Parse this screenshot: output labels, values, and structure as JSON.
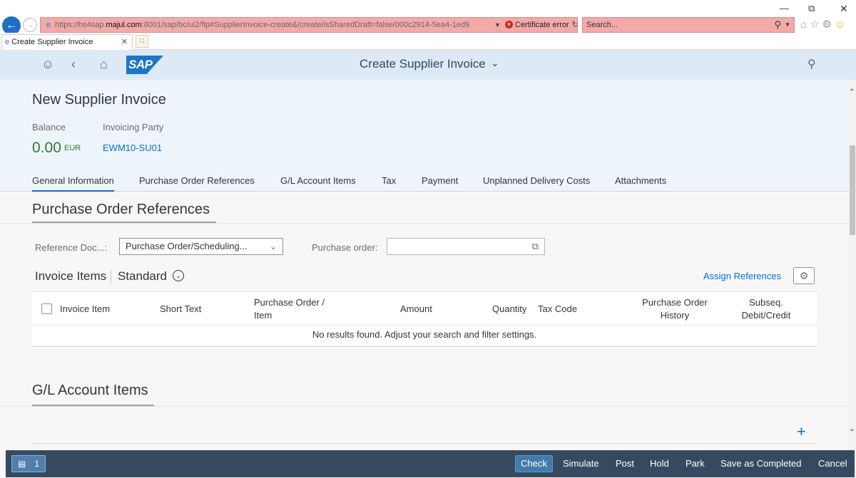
{
  "browser": {
    "url_prefix": "https://hs4sap.",
    "url_domain": "majul.com",
    "url_rest": ":8001/sap/bc/ui2/flp#SupplierInvoice-create&/create/isSharedDraft=false/000c2914-5ea4-1ed9",
    "certificate_error": "Certificate error",
    "search_placeholder": "Search...",
    "tab_title": "Create Supplier Invoice"
  },
  "shell": {
    "logo_text": "SAP",
    "title": "Create Supplier Invoice"
  },
  "header": {
    "title": "New Supplier Invoice",
    "balance_label": "Balance",
    "balance_value": "0.00",
    "balance_currency": "EUR",
    "invoicing_party_label": "Invoicing Party",
    "invoicing_party_value": "EWM10-SU01"
  },
  "tabs": [
    {
      "label": "General Information",
      "active": true
    },
    {
      "label": "Purchase Order References"
    },
    {
      "label": "G/L Account Items"
    },
    {
      "label": "Tax"
    },
    {
      "label": "Payment"
    },
    {
      "label": "Unplanned Delivery Costs"
    },
    {
      "label": "Attachments"
    }
  ],
  "po_references": {
    "title": "Purchase Order References",
    "reference_doc_label": "Reference Doc...:",
    "reference_doc_value": "Purchase Order/Scheduling...",
    "purchase_order_label": "Purchase order:",
    "purchase_order_value": ""
  },
  "invoice_items": {
    "title": "Invoice Items",
    "variant": "Standard",
    "assign_references": "Assign References",
    "columns": {
      "invoice_item": "Invoice Item",
      "short_text": "Short Text",
      "po_item_line1": "Purchase Order /",
      "po_item_line2": "Item",
      "amount": "Amount",
      "quantity": "Quantity",
      "tax_code": "Tax Code",
      "po_history_line1": "Purchase Order",
      "po_history_line2": "History",
      "subseq_line1": "Subseq.",
      "subseq_line2": "Debit/Credit"
    },
    "no_data": "No results found. Adjust your search and filter settings."
  },
  "gl_items": {
    "title": "G/L Account Items"
  },
  "footer": {
    "message_count": "1",
    "check": "Check",
    "simulate": "Simulate",
    "post": "Post",
    "hold": "Hold",
    "park": "Park",
    "save_completed": "Save as Completed",
    "cancel": "Cancel"
  }
}
